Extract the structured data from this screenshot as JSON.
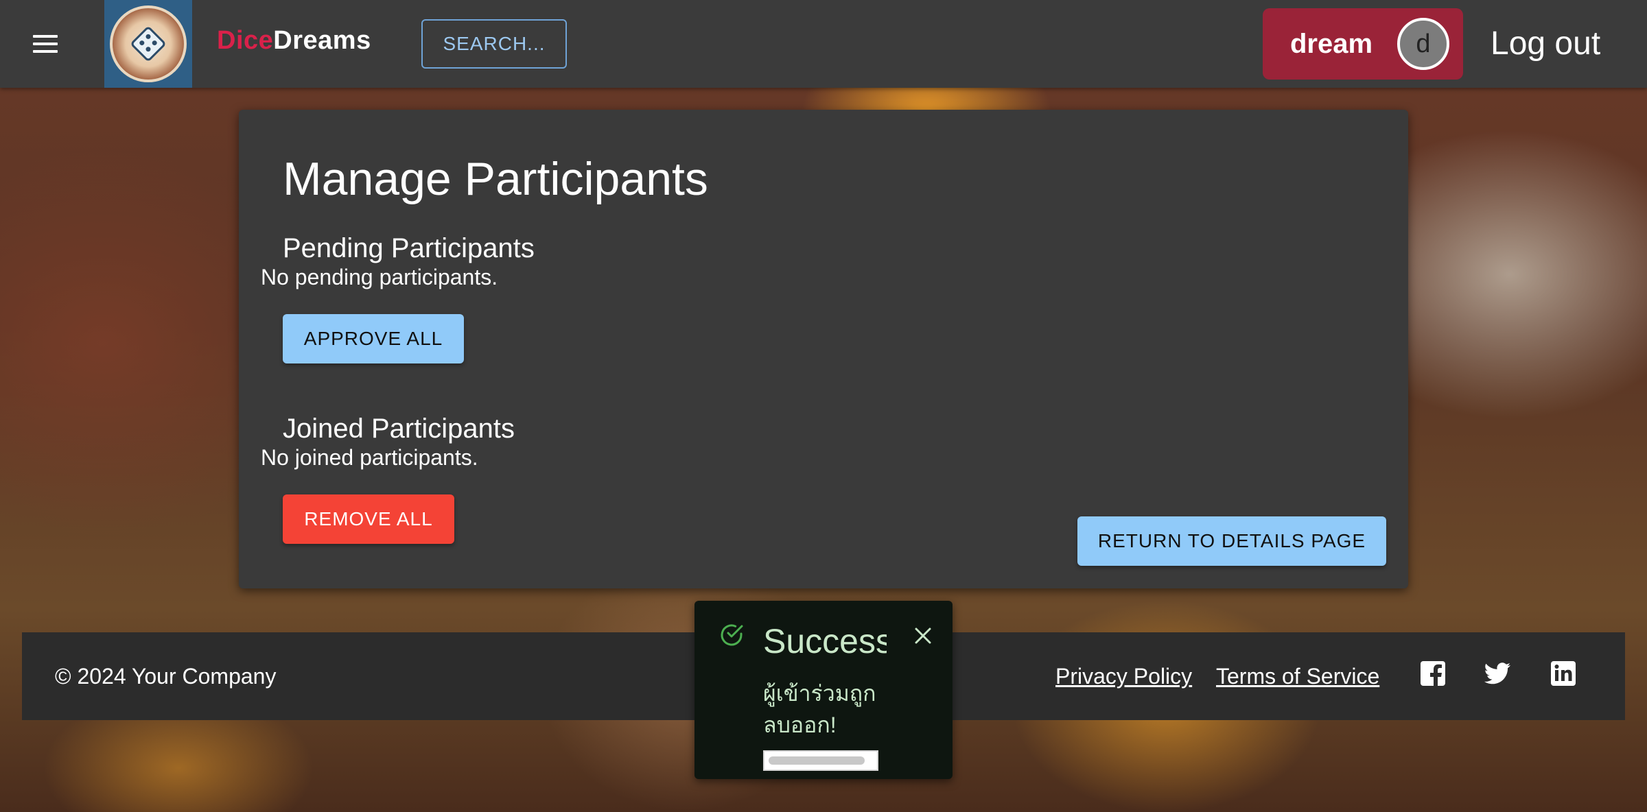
{
  "header": {
    "brand_part1": "Dice",
    "brand_part2": "Dreams",
    "search_label": "SEARCH...",
    "username": "dream",
    "avatar_initial": "d",
    "logout_label": "Log out",
    "menu_icon": "hamburger-menu-icon",
    "logo_icon": "dicedreams-logo"
  },
  "main": {
    "title": "Manage Participants",
    "pending": {
      "title": "Pending Participants",
      "empty_text": "No pending participants.",
      "button_label": "APPROVE ALL"
    },
    "joined": {
      "title": "Joined Participants",
      "empty_text": "No joined participants.",
      "button_label": "REMOVE ALL"
    },
    "return_label": "RETURN TO DETAILS PAGE"
  },
  "footer": {
    "copyright": "© 2024 Your Company",
    "privacy_label": "Privacy Policy",
    "terms_label": "Terms of Service",
    "social_icons": [
      "facebook-icon",
      "twitter-icon",
      "linkedin-icon"
    ]
  },
  "toast": {
    "title": "Success",
    "message": "ผู้เข้าร่วมถูกลบออก!",
    "progress_percent": 92
  },
  "colors": {
    "brand_red": "#d9214a",
    "user_chip": "#9a2338",
    "primary_blue": "#90caf9",
    "danger_red": "#f44336",
    "success_green": "#4caf50"
  }
}
